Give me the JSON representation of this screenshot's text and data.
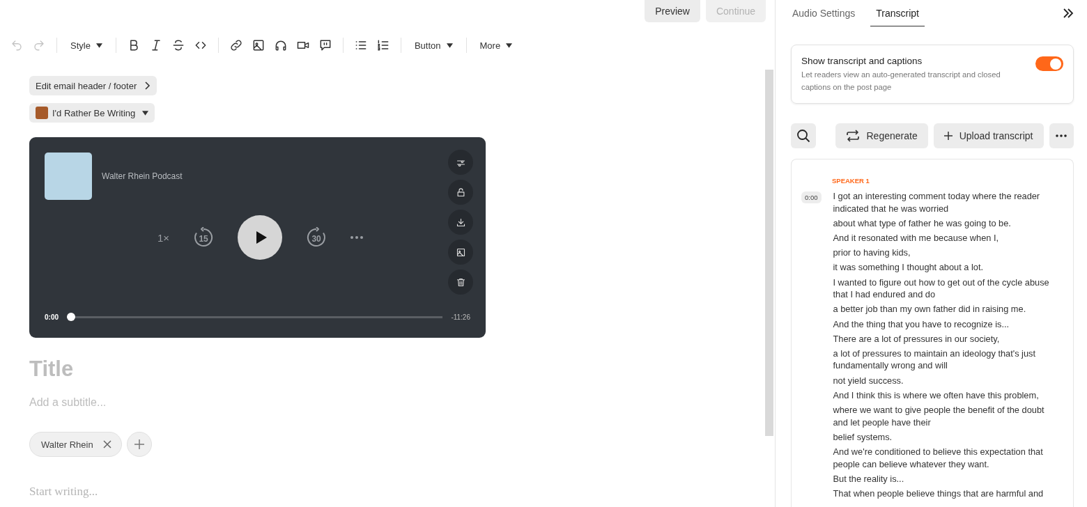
{
  "top_actions": [
    {
      "label": "Preview",
      "disabled": false
    },
    {
      "label": "Continue",
      "disabled": true
    }
  ],
  "toolbar": {
    "history": [
      {
        "disabled": true
      },
      {
        "disabled": true
      }
    ],
    "style_dropdown": "Style",
    "button_dropdown": "Button",
    "more_dropdown": "More"
  },
  "header_link": {
    "label": "Edit email header / footer"
  },
  "publication": {
    "label": "I'd Rather Be Writing"
  },
  "player": {
    "title": "Walter Rhein Podcast",
    "speed": "1×",
    "skip_back": "15",
    "skip_forward": "30",
    "elapsed": "0:00",
    "remaining": "-11:26",
    "level": 0
  },
  "post": {
    "title_placeholder": "Title",
    "subtitle_placeholder": "Add a subtitle...",
    "authors": [
      {
        "name": "Walter Rhein"
      }
    ],
    "body_placeholder": "Start writing..."
  },
  "panel": {
    "tabs": [
      {
        "label": "Audio Settings",
        "selected": false
      },
      {
        "label": "Transcript",
        "selected": true
      }
    ],
    "toggle": {
      "title": "Show transcript and captions",
      "description": "Let readers view an auto-generated transcript and closed captions on the post page",
      "on": true
    },
    "actions": [
      "Regenerate",
      "Upload transcript"
    ],
    "transcript": {
      "speaker": "SPEAKER 1",
      "timestamp": "0:00",
      "lines": [
        "I got an interesting comment today where the reader indicated that he was worried",
        "about what type of father he was going to be.",
        "And it resonated with me because when I,",
        "prior to having kids,",
        "it was something I thought about a lot.",
        "I wanted to figure out how to get out of the cycle abuse that I had endured and do",
        "a better job than my own father did in raising me.",
        "And the thing that you have to recognize is...",
        "There are a lot of pressures in our society,",
        "a lot of pressures to maintain an ideology that's just fundamentally wrong and will",
        "not yield success.",
        "And I think this is where we often have this problem,",
        "where we want to give people the benefit of the doubt and let people have their",
        "belief systems.",
        "And we're conditioned to believe this expectation that people can believe whatever they want.",
        "But the reality is...",
        "That when people believe things that are harmful and"
      ]
    }
  }
}
